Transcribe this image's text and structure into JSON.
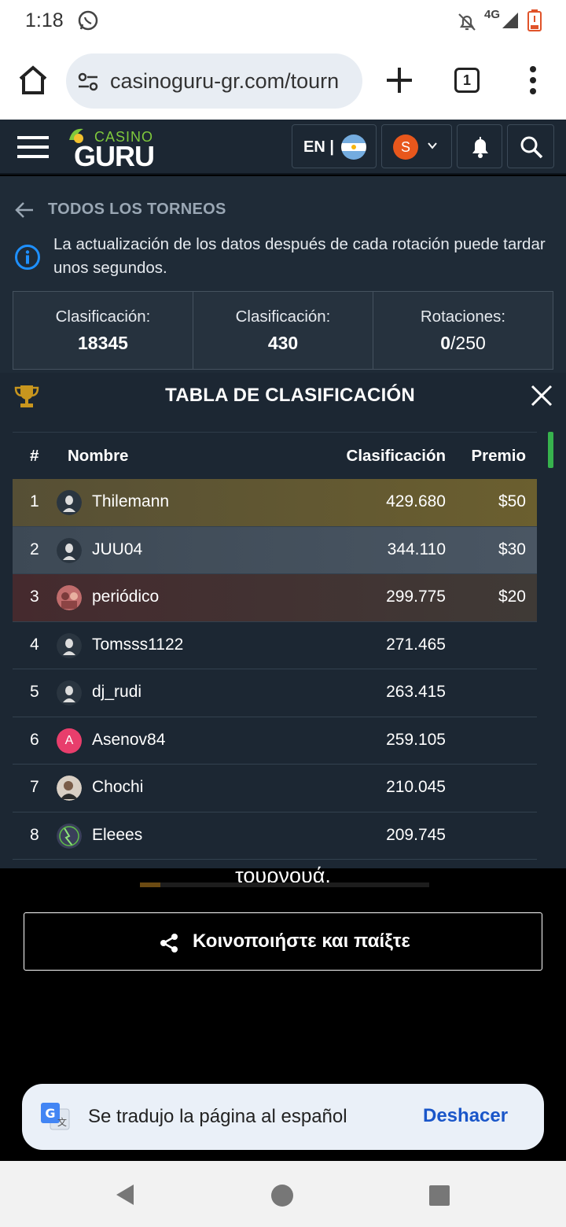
{
  "status_bar": {
    "time": "1:18",
    "network": "4G",
    "icons": [
      "whatsapp-icon",
      "bell-off-icon",
      "signal-icon",
      "battery-low-icon"
    ]
  },
  "browser": {
    "url": "casinoguru-gr.com/tourn",
    "tab_count": "1",
    "icons": [
      "home-icon",
      "site-settings-icon",
      "new-tab-icon",
      "tabs-icon",
      "menu-icon"
    ]
  },
  "site_header": {
    "logo_small": "CASINO",
    "logo_big": "GURU",
    "lang_label": "EN |",
    "user_initial": "S",
    "colors": {
      "header_bg": "#1c2733",
      "logo_green": "#7fc93c",
      "avatar": "#e8571c"
    }
  },
  "tournament": {
    "back_link": "TODOS LOS TORNEOS",
    "info_message": "La actualización de los datos después de cada rotación puede tardar unos segundos.",
    "stats": [
      {
        "label": "Clasificación:",
        "value": "18345"
      },
      {
        "label": "Clasificación:",
        "value": "430"
      },
      {
        "label": "Rotaciones:",
        "value_strong": "0",
        "value_rest": "/250"
      }
    ]
  },
  "leaderboard": {
    "title": "TABLA DE CLASIFICACIÓN",
    "columns": {
      "rank": "#",
      "name": "Nombre",
      "score": "Clasificación",
      "prize": "Premio"
    },
    "rows": [
      {
        "rank": "1",
        "name": "Thilemann",
        "score": "429.680",
        "prize": "$50",
        "avatar": "default"
      },
      {
        "rank": "2",
        "name": "JUU04",
        "score": "344.110",
        "prize": "$30",
        "avatar": "default"
      },
      {
        "rank": "3",
        "name": "periódico",
        "score": "299.775",
        "prize": "$20",
        "avatar": "photo"
      },
      {
        "rank": "4",
        "name": "Tomsss1122",
        "score": "271.465",
        "prize": "",
        "avatar": "default"
      },
      {
        "rank": "5",
        "name": "dj_rudi",
        "score": "263.415",
        "prize": "",
        "avatar": "default"
      },
      {
        "rank": "6",
        "name": "Asenov84",
        "score": "259.105",
        "prize": "",
        "avatar": "letter",
        "avatar_letter": "A"
      },
      {
        "rank": "7",
        "name": "Chochi",
        "score": "210.045",
        "prize": "",
        "avatar": "photo"
      },
      {
        "rank": "8",
        "name": "Eleees",
        "score": "209.745",
        "prize": "",
        "avatar": "photo-green"
      }
    ],
    "colors": {
      "gold": "#6b5f2f",
      "silver": "#4a5663",
      "bronze": "#452a2e",
      "scroll": "#37b24d"
    }
  },
  "below_table": {
    "partial_text": "τουρνουά.",
    "progress": 0.07,
    "share_button": "Κοινοποιήστε και παίξτε"
  },
  "translate_toast": {
    "message": "Se tradujo la página al español",
    "action": "Deshacer"
  }
}
